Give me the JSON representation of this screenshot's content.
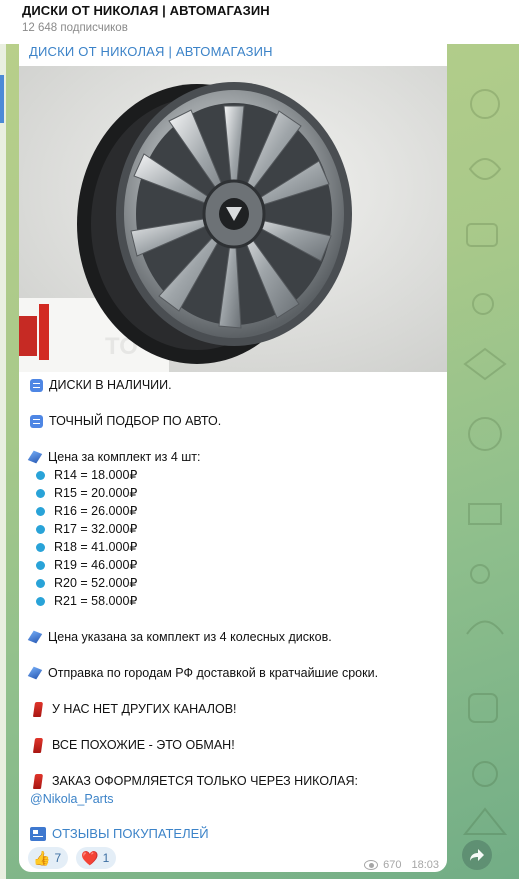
{
  "header": {
    "title": "ДИСКИ ОТ НИКОЛАЯ | АВТОМАГАЗИН",
    "subscribers": "12 648 подписчиков"
  },
  "post": {
    "channel_name": "ДИСКИ ОТ НИКОЛАЯ | АВТОМАГАЗИН",
    "line_stock": "ДИСКИ В НАЛИЧИИ.",
    "line_fit": "ТОЧНЫЙ ПОДБОР ПО АВТО.",
    "price_title": "Цена за комплект из 4 шт:",
    "prices": [
      "R14 = 18.000₽",
      "R15 = 20.000₽",
      "R16 = 26.000₽",
      "R17 = 32.000₽",
      "R18 = 41.000₽",
      "R19 = 46.000₽",
      "R20 = 52.000₽",
      "R21 = 58.000₽"
    ],
    "line_price_note": "Цена указана за комплект из 4 колесных дисков.",
    "line_shipping": "Отправка по городам РФ доставкой в кратчайшие сроки.",
    "line_no_channels": "У НАС НЕТ ДРУГИХ КАНАЛОВ!",
    "line_fakes": "ВСЕ ПОХОЖИЕ - ЭТО ОБМАН!",
    "line_order": "ЗАКАЗ ОФОРМЛЯЕТСЯ ТОЛЬКО ЧЕРЕЗ НИКОЛАЯ:",
    "contact": "@Nikola_Parts",
    "reviews_link": "ОТЗЫВЫ ПОКУПАТЕЛЕЙ",
    "photo_box_text": "TO",
    "reactions": [
      {
        "emoji": "👍",
        "count": "7"
      },
      {
        "emoji": "❤️",
        "count": "1"
      }
    ],
    "views": "670",
    "time": "18:03"
  },
  "icons": {
    "doc": "document-icon",
    "diamond": "blue-diamond-icon",
    "dot": "blue-dot-icon",
    "flag": "red-flag-icon",
    "news": "newspaper-icon",
    "eye": "views-eye-icon",
    "share": "share-arrow-icon"
  },
  "colors": {
    "link": "#3c83c8",
    "chat_bg": "#a9c98a",
    "reaction_bg": "#e4eef7"
  }
}
